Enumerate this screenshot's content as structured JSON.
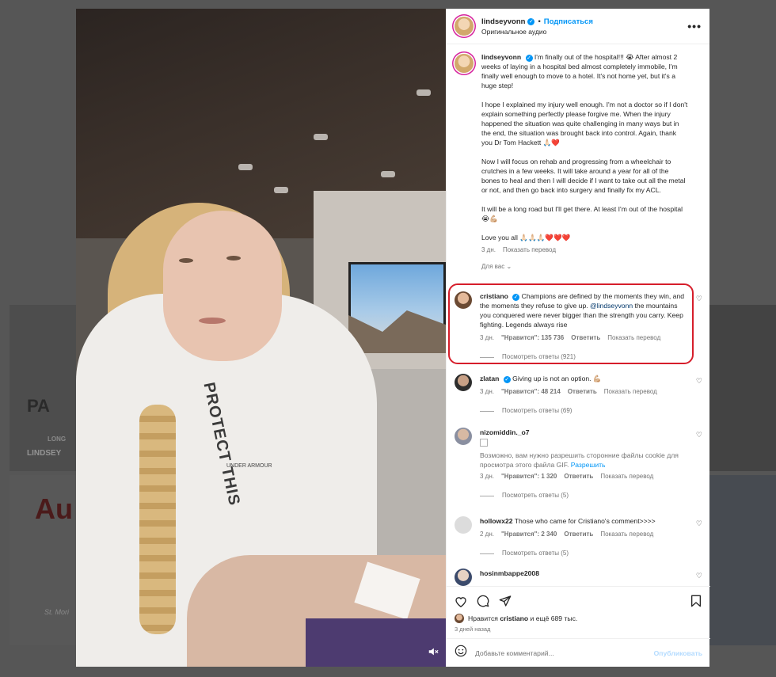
{
  "background_feed": {
    "tiles_text": [
      "PA",
      "LINDSEY",
      "Au",
      "St. Mori",
      "LONG"
    ]
  },
  "media": {
    "hoodie_print": "PROTECT THIS",
    "hoodie_brand": "UNDER ARMOUR",
    "mute_icon": "volume-off-icon"
  },
  "post": {
    "author": "lindseyvonn",
    "follow_label": "Подписаться",
    "audio": "Оригинальное аудио",
    "caption_paragraphs": [
      "I'm finally out of the hospital!!! 😭 After almost 2 weeks of laying in a hospital bed almost completely immobile, I'm finally well enough to move to a hotel. It's not home yet, but it's a huge step!",
      "I hope I explained my injury well enough. I'm not a doctor so if I don't explain something perfectly please forgive me. When the injury happened the situation was quite challenging in many ways but in the end, the situation was brought back into control. Again, thank you Dr Tom Hackett 🙏🏻❤️",
      "Now I will focus on rehab and progressing from a wheelchair to crutches in a few weeks. It will take around a year for all of the bones to heal and then I will decide if I want to take out all the metal or not, and then go back into surgery and finally fix my ACL.",
      "It will be a long road but I'll get there. At least I'm out of the hospital 😭💪🏼",
      "Love you all 🙏🏻🙏🏻🙏🏻❤️❤️❤️"
    ],
    "caption_time": "3 дн.",
    "show_translation": "Показать перевод",
    "for_you": "Для вас"
  },
  "comments": [
    {
      "user": "cristiano",
      "verified": true,
      "text_before": "Champions are defined by the moments they win, and the moments they refuse to give up. ",
      "mention": "@lindseyvonn",
      "text_after": " the mountains you conquered were never bigger than the strength you carry. Keep fighting. Legends always rise",
      "time": "3 дн.",
      "likes": "\"Нравится\": 135 736",
      "reply": "Ответить",
      "translate": "Показать перевод",
      "replies": "Посмотреть ответы (921)"
    },
    {
      "user": "zlatan",
      "verified": true,
      "text": "Giving up is not an option. 💪🏼",
      "time": "3 дн.",
      "likes": "\"Нравится\": 48 214",
      "reply": "Ответить",
      "translate": "Показать перевод",
      "replies": "Посмотреть ответы (69)"
    },
    {
      "user": "nizomiddin._o7",
      "verified": false,
      "text": "Возможно, вам нужно разрешить сторонние файлы cookie для просмотра этого файла GIF.",
      "allow": "Разрешить",
      "time": "3 дн.",
      "likes": "\"Нравится\": 1 320",
      "reply": "Ответить",
      "translate": "Показать перевод",
      "replies": "Посмотреть ответы (5)"
    },
    {
      "user": "hollowx22",
      "verified": false,
      "text": "Those who came for Cristiano's comment>>>>",
      "time": "2 дн.",
      "likes": "\"Нравится\": 2 340",
      "reply": "Ответить",
      "translate": "Показать перевод",
      "replies": "Посмотреть ответы (5)"
    },
    {
      "user": "hosinmbappe2008",
      "verified": false,
      "text": ""
    }
  ],
  "footer": {
    "liked_by_prefix": "Нравится ",
    "liked_by_user": "cristiano",
    "liked_by_suffix": " и ещё 689 тыс.",
    "time": "3 дней назад",
    "comment_placeholder": "Добавьте комментарий...",
    "publish": "Опубликовать"
  },
  "colors": {
    "accent": "#0095f6",
    "highlight": "#d61e2b"
  }
}
